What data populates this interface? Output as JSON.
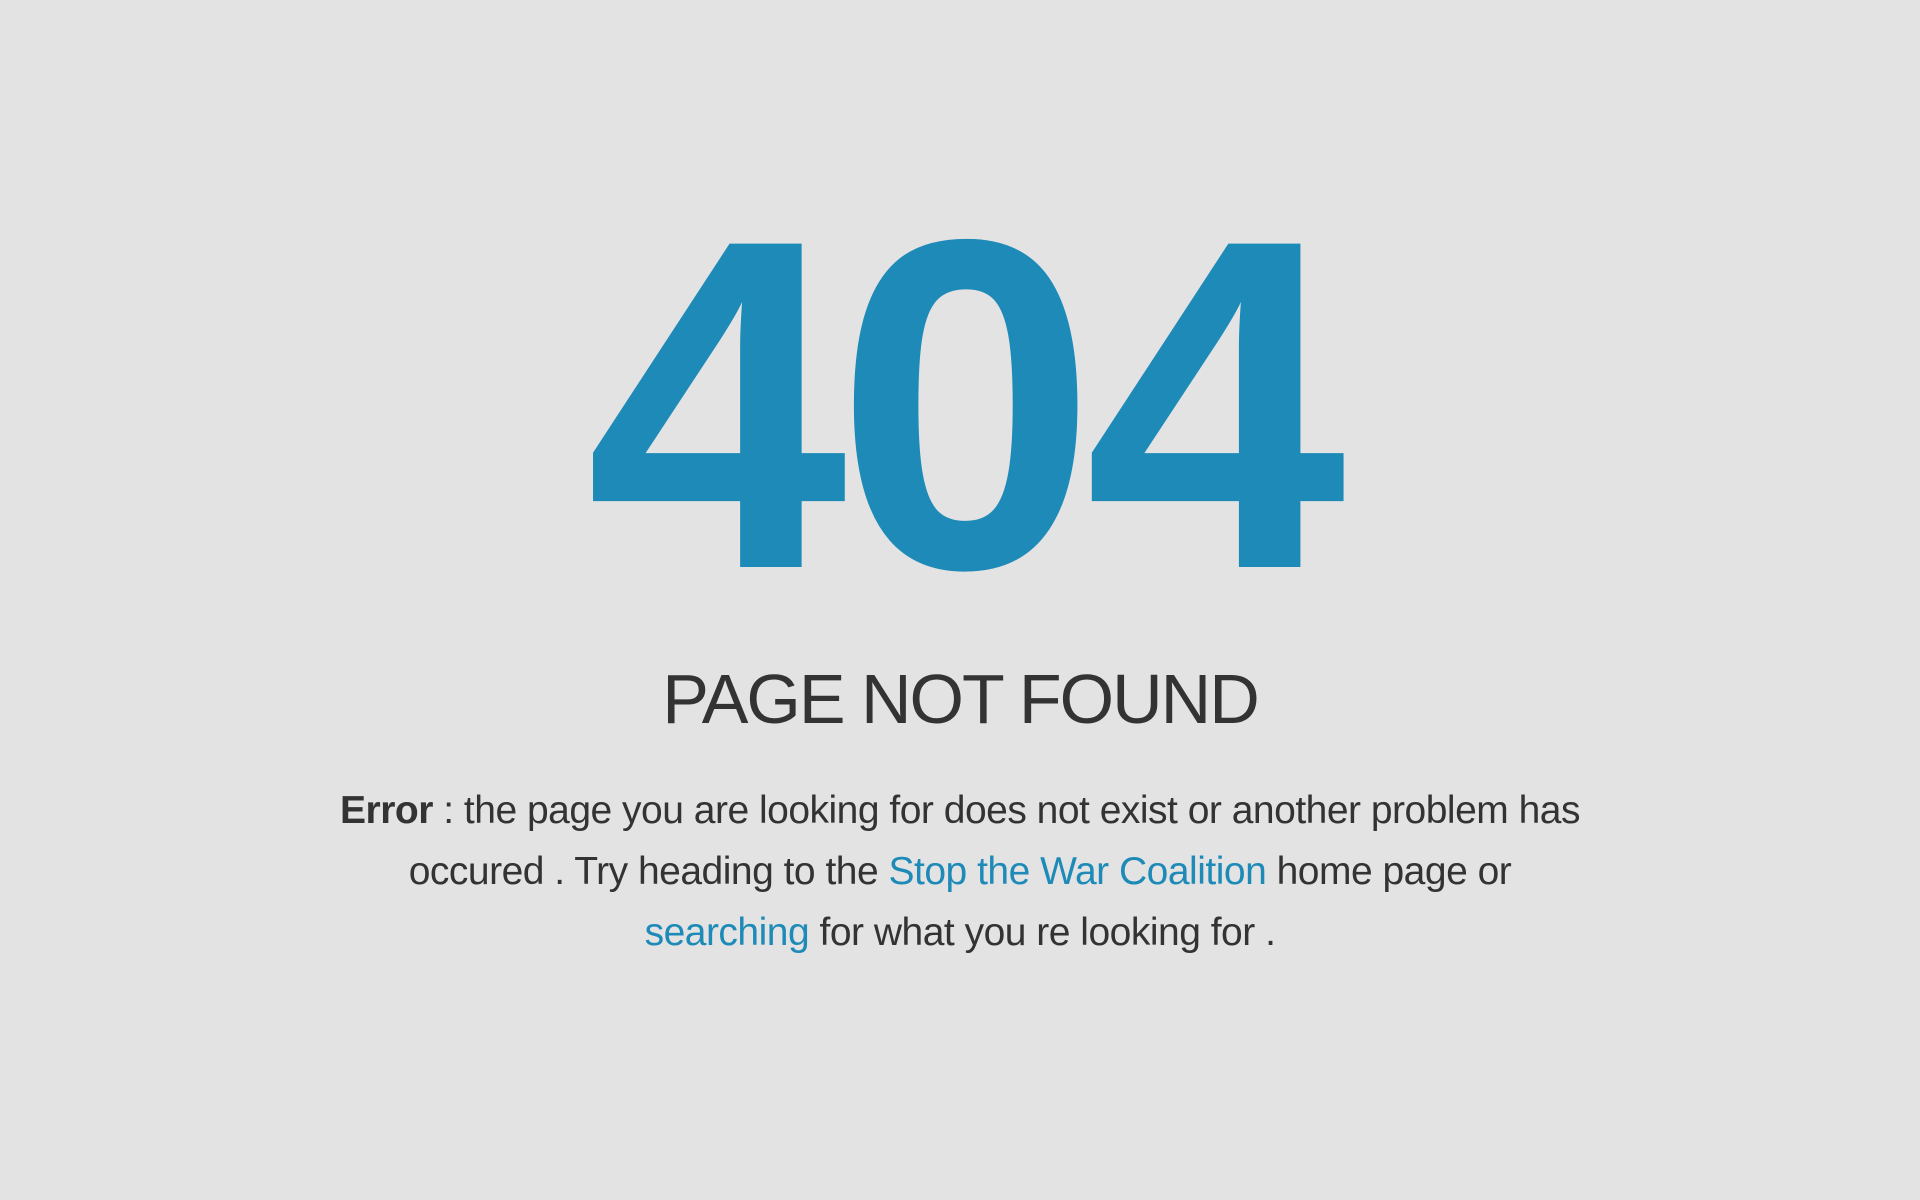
{
  "error_code": "404",
  "heading": "PAGE NOT FOUND",
  "message": {
    "label": "Error",
    "part1": " : the page you are looking for does not exist or another problem has occured . Try heading to the ",
    "home_link": "Stop the War Coalition",
    "part2": " home page or ",
    "search_link": "searching",
    "part3": " for what you re looking for ."
  },
  "colors": {
    "background": "#e3e3e3",
    "accent": "#1d8ab8",
    "text": "#333333"
  }
}
